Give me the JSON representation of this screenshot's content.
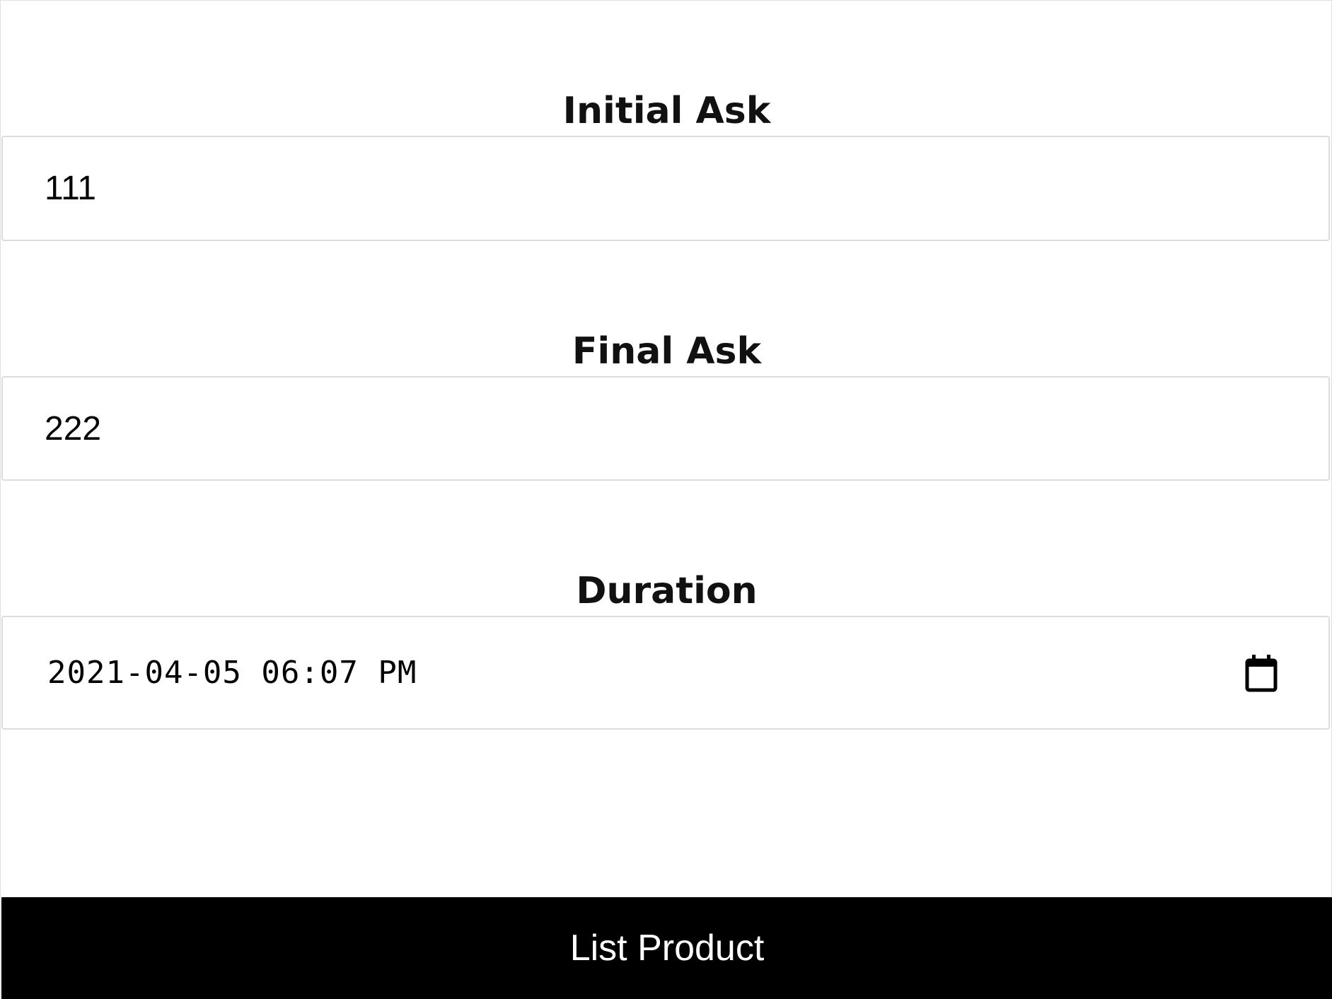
{
  "form": {
    "initial_ask": {
      "label": "Initial Ask",
      "value": "111"
    },
    "final_ask": {
      "label": "Final Ask",
      "value": "222"
    },
    "duration": {
      "label": "Duration",
      "value": "2021-04-05 06:07 PM",
      "icon": "calendar-icon"
    },
    "submit_label": "List Product"
  }
}
